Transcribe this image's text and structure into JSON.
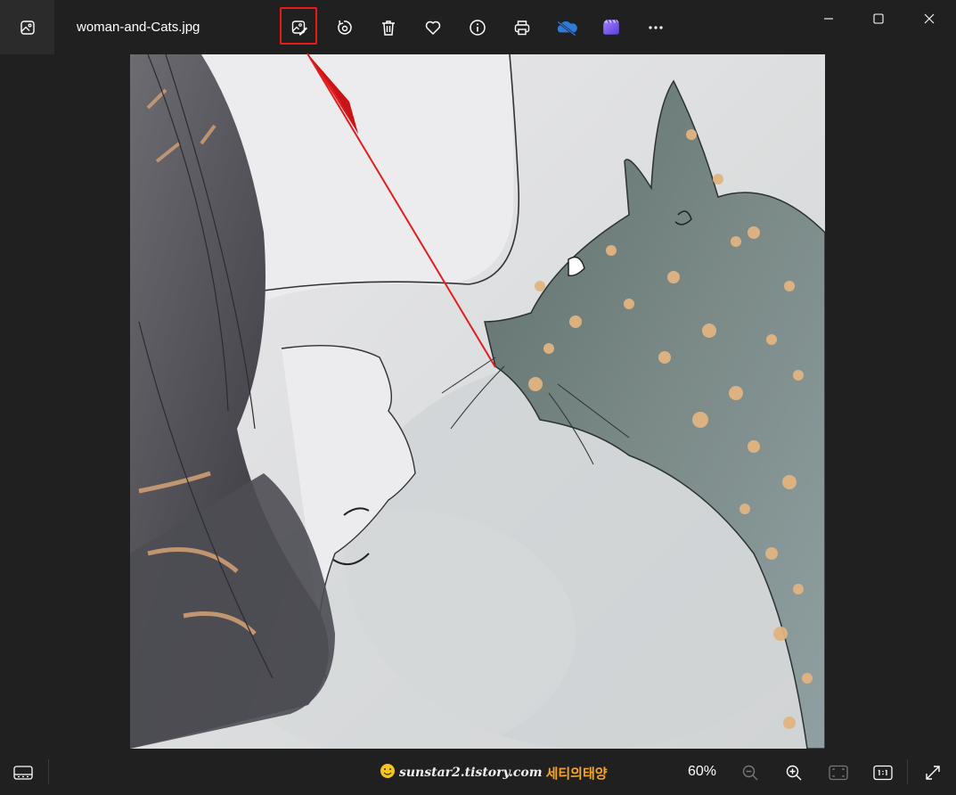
{
  "window": {
    "filename": "woman-and-Cats.jpg",
    "controls": {
      "minimize": "minimize-icon",
      "maximize": "maximize-icon",
      "close": "close-icon"
    }
  },
  "toolbar": {
    "buttons": [
      {
        "name": "edit-image",
        "icon": "edit-image-icon"
      },
      {
        "name": "rotate",
        "icon": "rotate-icon"
      },
      {
        "name": "delete",
        "icon": "trash-icon"
      },
      {
        "name": "favorite",
        "icon": "heart-icon"
      },
      {
        "name": "file-info",
        "icon": "info-icon"
      },
      {
        "name": "print",
        "icon": "print-icon"
      },
      {
        "name": "onedrive",
        "icon": "cloud-icon"
      },
      {
        "name": "clipchamp",
        "icon": "clipchamp-icon"
      },
      {
        "name": "more",
        "icon": "more-icon"
      }
    ],
    "highlighted": "edit-image"
  },
  "bottombar": {
    "watermark_site": "sunstar2.tistory.com",
    "watermark_kr": "세티의태양",
    "zoom": "60%",
    "buttons": [
      "filmstrip-icon",
      "zoom-out-icon",
      "zoom-in-icon",
      "fit-to-window-icon",
      "actual-size-icon",
      "full-screen-icon"
    ]
  },
  "colors": {
    "background": "#202020",
    "highlight": "#e81b1b",
    "onedrive": "#2f7ad9",
    "clipchamp": "#7a5af8"
  }
}
